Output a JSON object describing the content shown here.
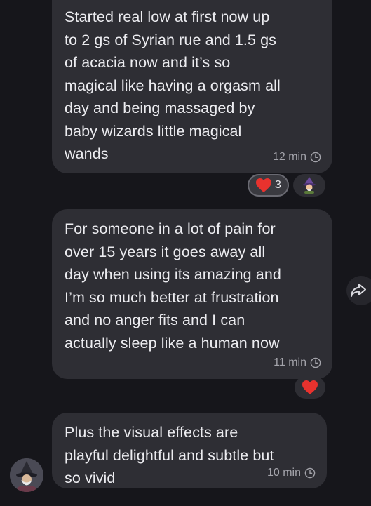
{
  "messages": [
    {
      "text": "Started real low at first now up\nto 2 gs of Syrian rue and 1.5 gs\nof acacia now and it’s so\nmagical like having a orgasm all\nday and being massaged by\nbaby wizards little magical\nwands",
      "time": "12 min",
      "reactions": [
        {
          "emoji": "❤️",
          "count": "3"
        },
        {
          "emoji": "🧙"
        }
      ]
    },
    {
      "text": "For someone in a lot of pain for\nover 15 years it goes away all\nday when using its amazing and\nI’m so much better at frustration\nand no anger fits and I can\nactually sleep like a human now",
      "time": "11 min",
      "reactions": [
        {
          "emoji": "❤️"
        }
      ]
    },
    {
      "text": "Plus the visual effects are\nplayful delightful and subtle but\nso vivid",
      "time": "10 min"
    }
  ],
  "icons": {
    "clock": "clock-icon",
    "share": "share-icon",
    "avatar": "wizard-avatar"
  },
  "colors": {
    "background": "#16161b",
    "bubble": "#2e2e34",
    "text": "#ececf0",
    "meta": "#a4a4ab",
    "heart": "#e8322e"
  }
}
